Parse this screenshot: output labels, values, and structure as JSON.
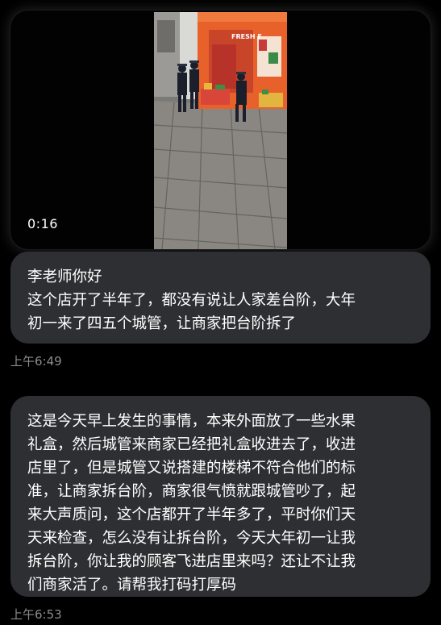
{
  "messages": [
    {
      "type": "video",
      "duration": "0:16",
      "thumbnail": {
        "sign_text": "FRESH F",
        "scene": "storefront-street-with-officers-icon"
      }
    },
    {
      "type": "text",
      "lines": [
        "李老师你好",
        "这个店开了半年了，都没有说让人家差台阶，大年",
        "初一来了四五个城管，让商家把台阶拆了"
      ],
      "time": "上午6:49"
    },
    {
      "type": "text",
      "lines": [
        "这是今天早上发生的事情，本来外面放了一些水果",
        "礼盒，然后城管来商家已经把礼盒收进去了，收进",
        "店里了，但是城管又说搭建的楼梯不符合他们的标",
        "准，让商家拆台阶，商家很气愤就跟城管吵了，起",
        "来大声质问，这个店都开了半年多了，平时你们天",
        "天来检查，怎么没有让拆台阶，今天大年初一让我",
        "拆台阶，你让我的顾客飞进店里来吗？还让不让我",
        "们商家活了。请帮我打码打厚码"
      ],
      "time": "上午6:53"
    }
  ],
  "colors": {
    "background": "#000000",
    "bubble": "#2e2f32",
    "text": "#ffffff",
    "timestamp": "#8b8d90",
    "storefront": "#e8612a"
  }
}
